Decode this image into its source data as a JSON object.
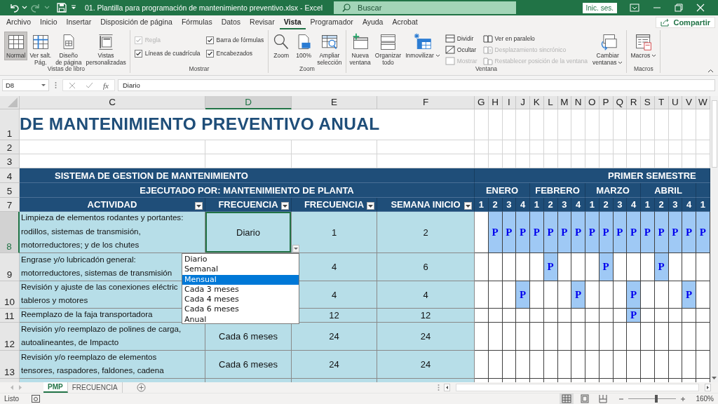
{
  "window": {
    "title": "01. Plantilla para programación de mantenimiento preventivo.xlsx  -  Excel",
    "search": {
      "placeholder": "Buscar"
    },
    "sign_in": "Inic. ses."
  },
  "menu_tabs": [
    {
      "label": "Archivo",
      "selected": false
    },
    {
      "label": "Inicio",
      "selected": false
    },
    {
      "label": "Insertar",
      "selected": false
    },
    {
      "label": "Disposición de página",
      "selected": false
    },
    {
      "label": "Fórmulas",
      "selected": false
    },
    {
      "label": "Datos",
      "selected": false
    },
    {
      "label": "Revisar",
      "selected": false
    },
    {
      "label": "Vista",
      "selected": true
    },
    {
      "label": "Programador",
      "selected": false
    },
    {
      "label": "Ayuda",
      "selected": false
    },
    {
      "label": "Acrobat",
      "selected": false
    }
  ],
  "share_button": "Compartir",
  "ribbon": [
    {
      "label": "Vistas de libro",
      "items": [
        {
          "kind": "large",
          "label": "Normal",
          "selected": true
        },
        {
          "kind": "large",
          "label": "Ver salt.\nPág.",
          "selected": false
        },
        {
          "kind": "large",
          "label": "Diseño\nde página",
          "selected": false
        },
        {
          "kind": "large",
          "label": "Vistas\npersonalizadas",
          "selected": false
        }
      ]
    },
    {
      "label": "Mostrar",
      "items": [
        {
          "kind": "stack",
          "items": [
            {
              "kind": "check",
              "label": "Regla",
              "checked": true,
              "disabled": true
            },
            {
              "kind": "check",
              "label": "Líneas de cuadrícula",
              "checked": true,
              "disabled": false
            }
          ]
        },
        {
          "kind": "stack",
          "items": [
            {
              "kind": "check",
              "label": "Barra de fórmulas",
              "checked": true,
              "disabled": false
            },
            {
              "kind": "check",
              "label": "Encabezados",
              "checked": true,
              "disabled": false
            }
          ]
        }
      ]
    },
    {
      "label": "Zoom",
      "items": [
        {
          "kind": "large",
          "label": "Zoom",
          "selected": false
        },
        {
          "kind": "large",
          "label": "100%",
          "selected": false
        },
        {
          "kind": "large",
          "label": "Ampliar\nselección",
          "selected": false
        }
      ]
    },
    {
      "label": "Ventana",
      "items": [
        {
          "kind": "large",
          "label": "Nueva\nventana",
          "selected": false
        },
        {
          "kind": "large",
          "label": "Organizar\ntodo",
          "selected": false
        },
        {
          "kind": "large",
          "label": "Inmovilizar",
          "selected": false,
          "menu": true
        },
        {
          "kind": "stack",
          "items": [
            {
              "kind": "small",
              "label": "Dividir",
              "disabled": false
            },
            {
              "kind": "small",
              "label": "Ocultar",
              "disabled": false
            },
            {
              "kind": "small",
              "label": "Mostrar",
              "disabled": true
            }
          ]
        },
        {
          "kind": "stack",
          "items": [
            {
              "kind": "small",
              "label": "Ver en paralelo",
              "disabled": false
            },
            {
              "kind": "small",
              "label": "Desplazamiento sincrónico",
              "disabled": true
            },
            {
              "kind": "small",
              "label": "Restablecer posición de la ventana",
              "disabled": true
            }
          ]
        },
        {
          "kind": "large",
          "label": "Cambiar\nventanas",
          "selected": false,
          "menu": true
        }
      ]
    },
    {
      "label": "Macros",
      "items": [
        {
          "kind": "large",
          "label": "Macros",
          "selected": false,
          "menu": true
        }
      ]
    }
  ],
  "formula_bar": {
    "name_box": "D8",
    "function_label": "fx",
    "value": "Diario"
  },
  "sheet": {
    "columns": [
      {
        "label": "C",
        "selected": false
      },
      {
        "label": "D",
        "selected": true
      },
      {
        "label": "E",
        "selected": false
      },
      {
        "label": "F",
        "selected": false
      },
      {
        "label": "G",
        "selected": false
      },
      {
        "label": "H",
        "selected": false
      },
      {
        "label": "I",
        "selected": false
      },
      {
        "label": "J",
        "selected": false
      },
      {
        "label": "K",
        "selected": false
      },
      {
        "label": "L",
        "selected": false
      },
      {
        "label": "M",
        "selected": false
      },
      {
        "label": "N",
        "selected": false
      },
      {
        "label": "O",
        "selected": false
      },
      {
        "label": "P",
        "selected": false
      },
      {
        "label": "Q",
        "selected": false
      },
      {
        "label": "R",
        "selected": false
      },
      {
        "label": "S",
        "selected": false
      },
      {
        "label": "T",
        "selected": false
      },
      {
        "label": "U",
        "selected": false
      },
      {
        "label": "V",
        "selected": false
      },
      {
        "label": "W",
        "selected": false
      }
    ],
    "rows": [
      {
        "number": "1",
        "selected": false,
        "kind": "title",
        "text": "DE MANTENIMIENTO PREVENTIVO ANUAL"
      },
      {
        "number": "2",
        "selected": false,
        "kind": "blank"
      },
      {
        "number": "3",
        "selected": false,
        "kind": "blank"
      },
      {
        "number": "4",
        "selected": false,
        "kind": "band",
        "text": "SISTEMA DE GESTION DE MANTENIMIENTO",
        "right_text": "PRIMER SEMESTRE"
      },
      {
        "number": "5",
        "selected": false,
        "kind": "months",
        "text": "EJECUTADO POR: MANTENIMIENTO DE PLANTA",
        "months": [
          "ENERO",
          "FEBRERO",
          "MARZO",
          "ABRIL"
        ]
      },
      {
        "number": "7",
        "selected": false,
        "kind": "headings",
        "headings": [
          "ACTIVIDAD",
          "FRECUENCIA",
          "FRECUENCIA",
          "SEMANA INICIO"
        ],
        "weeks": [
          "1",
          "2",
          "3",
          "4",
          "1",
          "2",
          "3",
          "4",
          "1",
          "2",
          "3",
          "4",
          "1",
          "2",
          "3",
          "4",
          "1"
        ]
      },
      {
        "number": "8",
        "selected": true,
        "kind": "activity",
        "activity": "Limpieza de elementos rodantes y portantes:\nrodillos, sistemas de transmisión,\nmotorreductores; y de los chutes",
        "frequency": "Diario",
        "frequency_weeks": "1",
        "start_week": "2",
        "weeks": [
          {
            "planned": false
          },
          {
            "planned": true,
            "mark": "P"
          },
          {
            "planned": true,
            "mark": "P"
          },
          {
            "planned": true,
            "mark": "P"
          },
          {
            "planned": true,
            "mark": "P"
          },
          {
            "planned": true,
            "mark": "P"
          },
          {
            "planned": true,
            "mark": "P"
          },
          {
            "planned": true,
            "mark": "P"
          },
          {
            "planned": true,
            "mark": "P"
          },
          {
            "planned": true,
            "mark": "P"
          },
          {
            "planned": true,
            "mark": "P"
          },
          {
            "planned": true,
            "mark": "P"
          },
          {
            "planned": true,
            "mark": "P"
          },
          {
            "planned": true,
            "mark": "P"
          },
          {
            "planned": true,
            "mark": "P"
          },
          {
            "planned": true,
            "mark": "P"
          },
          {
            "planned": true,
            "mark": "P"
          }
        ]
      },
      {
        "number": "9",
        "selected": false,
        "kind": "activity",
        "activity": "Engrase y/o lubricadón general:\nmotorreductores, sistemas de transmisión",
        "frequency_weeks": "4",
        "start_week": "6",
        "weeks": [
          {
            "planned": false
          },
          {
            "planned": false
          },
          {
            "planned": false
          },
          {
            "planned": false
          },
          {
            "planned": false
          },
          {
            "planned": true,
            "mark": "P"
          },
          {
            "planned": false
          },
          {
            "planned": false
          },
          {
            "planned": false
          },
          {
            "planned": true,
            "mark": "P"
          },
          {
            "planned": false
          },
          {
            "planned": false
          },
          {
            "planned": false
          },
          {
            "planned": true,
            "mark": "P"
          },
          {
            "planned": false
          },
          {
            "planned": false
          },
          {
            "planned": false
          }
        ]
      },
      {
        "number": "10",
        "selected": false,
        "kind": "activity",
        "activity": "Revisión y ajuste de las conexiones eléctric\ntableros y motores",
        "frequency_weeks": "4",
        "start_week": "4",
        "weeks": [
          {
            "planned": false
          },
          {
            "planned": false
          },
          {
            "planned": false
          },
          {
            "planned": true,
            "mark": "P"
          },
          {
            "planned": false
          },
          {
            "planned": false
          },
          {
            "planned": false
          },
          {
            "planned": true,
            "mark": "P"
          },
          {
            "planned": false
          },
          {
            "planned": false
          },
          {
            "planned": false
          },
          {
            "planned": true,
            "mark": "P"
          },
          {
            "planned": false
          },
          {
            "planned": false
          },
          {
            "planned": false
          },
          {
            "planned": true,
            "mark": "P"
          },
          {
            "planned": false
          }
        ]
      },
      {
        "number": "11",
        "selected": false,
        "kind": "activity",
        "activity": "Reemplazo de la faja transportadora",
        "frequency_weeks": "12",
        "start_week": "12",
        "weeks": [
          {
            "planned": false
          },
          {
            "planned": false
          },
          {
            "planned": false
          },
          {
            "planned": false
          },
          {
            "planned": false
          },
          {
            "planned": false
          },
          {
            "planned": false
          },
          {
            "planned": false
          },
          {
            "planned": false
          },
          {
            "planned": false
          },
          {
            "planned": false
          },
          {
            "planned": true,
            "mark": "P"
          },
          {
            "planned": false
          },
          {
            "planned": false
          },
          {
            "planned": false
          },
          {
            "planned": false
          },
          {
            "planned": false
          }
        ]
      },
      {
        "number": "12",
        "selected": false,
        "kind": "activity",
        "activity": "Revisión y/o reemplazo de polines de carga,\nautoalineantes, de Impacto",
        "frequency": "Cada 6 meses",
        "frequency_weeks": "24",
        "start_week": "24",
        "weeks": [
          {
            "planned": false
          },
          {
            "planned": false
          },
          {
            "planned": false
          },
          {
            "planned": false
          },
          {
            "planned": false
          },
          {
            "planned": false
          },
          {
            "planned": false
          },
          {
            "planned": false
          },
          {
            "planned": false
          },
          {
            "planned": false
          },
          {
            "planned": false
          },
          {
            "planned": false
          },
          {
            "planned": false
          },
          {
            "planned": false
          },
          {
            "planned": false
          },
          {
            "planned": false
          },
          {
            "planned": false
          }
        ]
      },
      {
        "number": "13",
        "selected": false,
        "kind": "activity",
        "activity": "Revisión y/o reemplazo de elementos\ntensores, raspadores, faldones, cadena",
        "frequency": "Cada 6 meses",
        "frequency_weeks": "24",
        "start_week": "24",
        "weeks": [
          {
            "planned": false
          },
          {
            "planned": false
          },
          {
            "planned": false
          },
          {
            "planned": false
          },
          {
            "planned": false
          },
          {
            "planned": false
          },
          {
            "planned": false
          },
          {
            "planned": false
          },
          {
            "planned": false
          },
          {
            "planned": false
          },
          {
            "planned": false
          },
          {
            "planned": false
          },
          {
            "planned": false
          },
          {
            "planned": false
          },
          {
            "planned": false
          },
          {
            "planned": false
          },
          {
            "planned": false
          }
        ]
      }
    ],
    "dropdown": [
      {
        "label": "Diario",
        "selected": false
      },
      {
        "label": "Semanal",
        "selected": false
      },
      {
        "label": "Mensual",
        "selected": true
      },
      {
        "label": "Cada 3 meses",
        "selected": false
      },
      {
        "label": "Cada 4 meses",
        "selected": false
      },
      {
        "label": "Cada 6 meses",
        "selected": false
      },
      {
        "label": "Anual",
        "selected": false
      }
    ]
  },
  "sheet_tabs": [
    {
      "label": "PMP",
      "selected": true
    },
    {
      "label": "FRECUENCIA",
      "selected": false
    }
  ],
  "status_bar": {
    "status": "Listo",
    "views": [
      {
        "selected": true
      },
      {
        "selected": false
      },
      {
        "selected": false
      }
    ],
    "zoom": {
      "level": 0.58,
      "reading": "160%"
    }
  }
}
